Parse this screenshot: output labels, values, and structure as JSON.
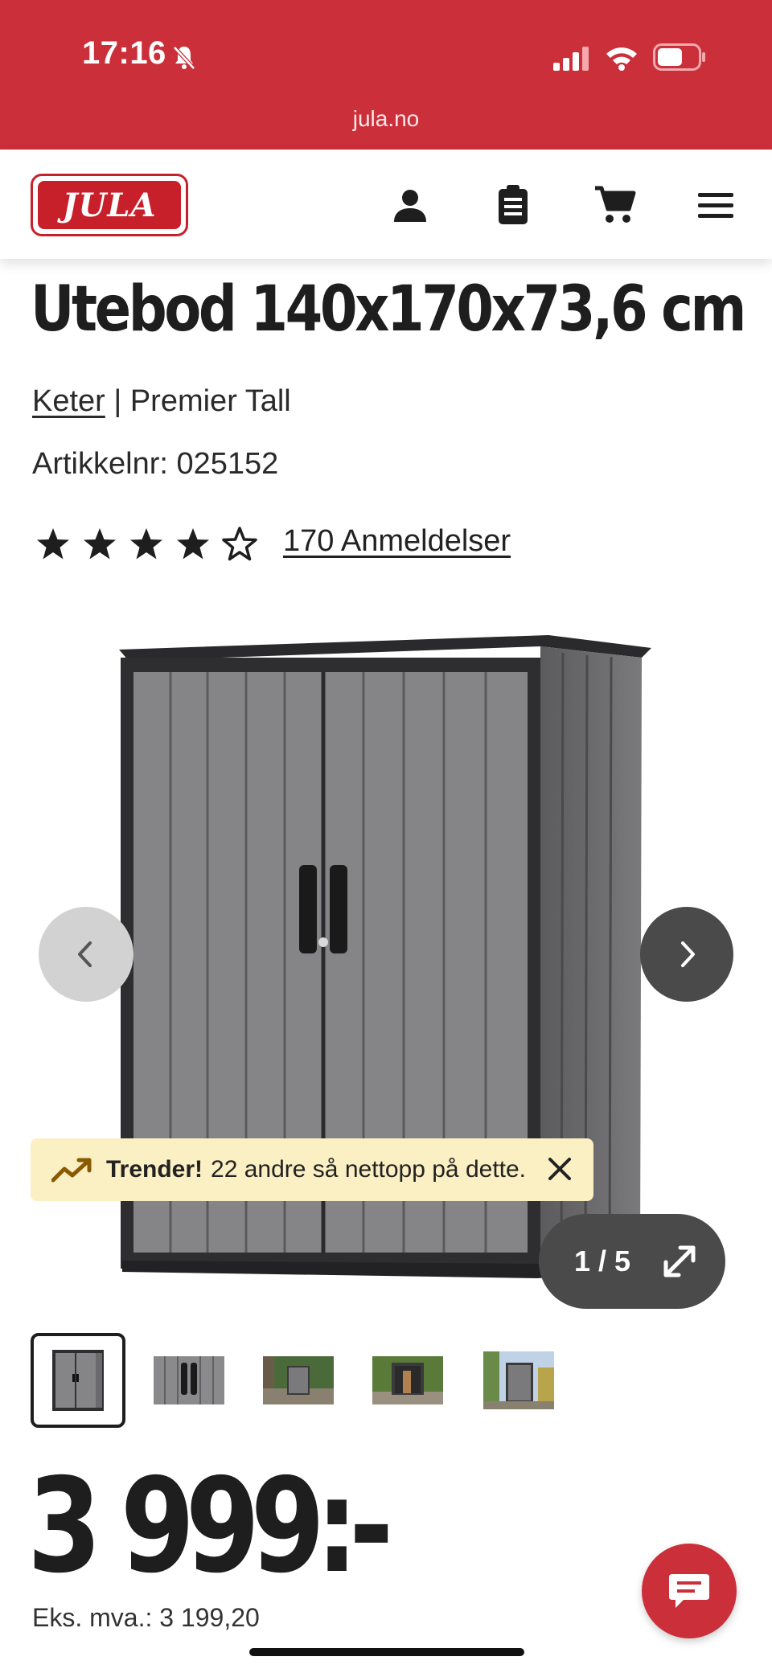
{
  "status_bar": {
    "time": "17:16"
  },
  "browser": {
    "url": "jula.no"
  },
  "header": {
    "logo_text": "JULA"
  },
  "product": {
    "title": "Utebod 140x170x73,6 cm",
    "brand": "Keter",
    "separator": " | ",
    "model": "Premier Tall",
    "article_number": "Artikkelnr: 025152",
    "rating": 4.5,
    "rating_max": 5,
    "reviews_label": "170 Anmeldelser"
  },
  "gallery": {
    "counter": "1 / 5",
    "current_index": 1,
    "total": 5,
    "trend_bold": "Trender!",
    "trend_text": "22 andre så nettopp på dette."
  },
  "price": {
    "amount": "3 999:-",
    "ex_vat": "Eks. mva.: 3 199,20"
  },
  "colors": {
    "brand_red": "#cb2f3a",
    "trend_bg": "#fbefc4",
    "dark_button": "#4a4a4a"
  }
}
